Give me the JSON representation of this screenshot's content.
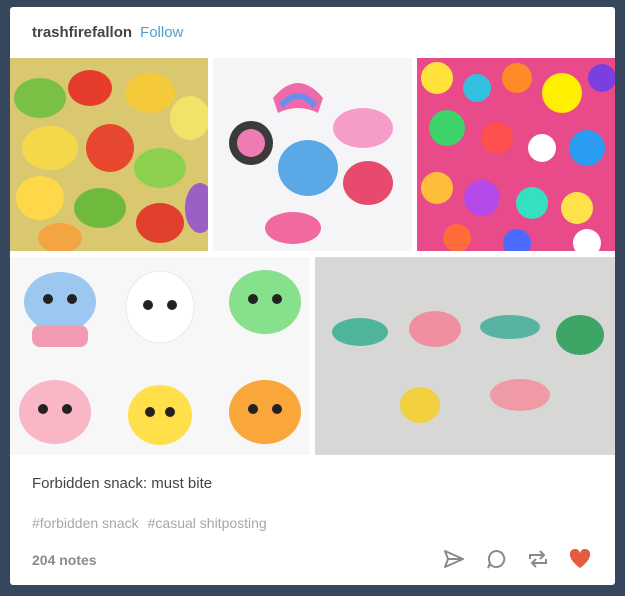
{
  "post": {
    "username": "trashfirefallon",
    "follow_label": "Follow",
    "caption": "Forbidden snack: must bite",
    "tags": [
      "#forbidden snack",
      "#casual shitposting"
    ],
    "notes": "204 notes",
    "actions": {
      "share_icon": "paper-plane-icon",
      "reply_icon": "speech-bubble-icon",
      "reblog_icon": "reblog-icon",
      "like_icon": "heart-icon"
    },
    "colors": {
      "background": "#36465d",
      "link": "#529ecc",
      "like": "#e65a3f",
      "icon": "#8a8a8a"
    }
  }
}
